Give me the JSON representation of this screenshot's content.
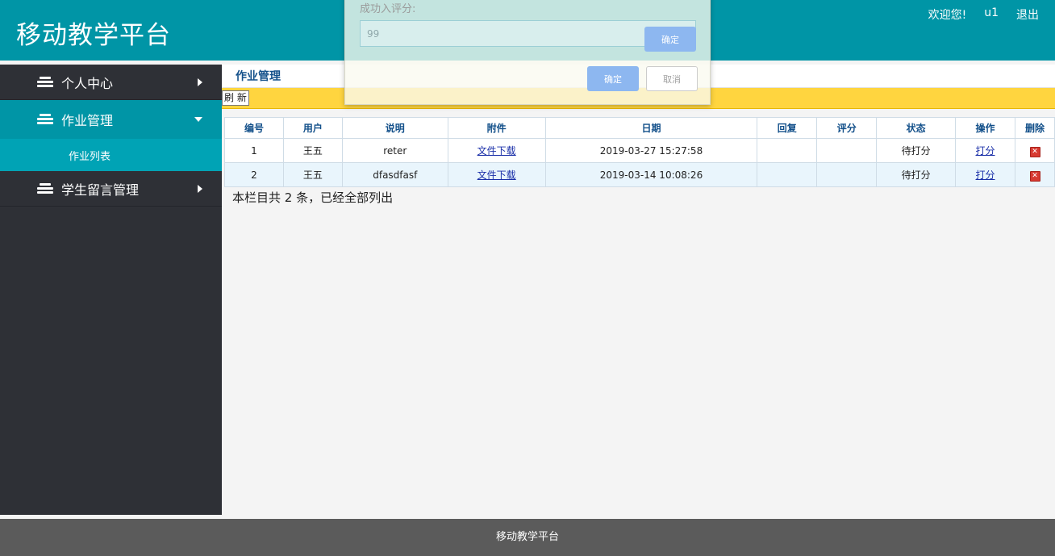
{
  "header": {
    "brand": "移动教学平台",
    "welcome": "欢迎您!",
    "username": "u1",
    "logout": "退出"
  },
  "sidebar": {
    "items": [
      {
        "label": "个人中心",
        "icon": "stack-icon"
      },
      {
        "label": "作业管理",
        "icon": "stack-icon",
        "subitems": [
          {
            "label": "作业列表"
          }
        ]
      },
      {
        "label": "学生留言管理",
        "icon": "stack-icon"
      }
    ]
  },
  "content": {
    "title": "作业管理",
    "refresh_label": "刷 新",
    "columns": [
      "编号",
      "用户",
      "说明",
      "附件",
      "日期",
      "回复",
      "评分",
      "状态",
      "操作",
      "删除"
    ],
    "rows": [
      {
        "id": "1",
        "user": "王五",
        "desc": "reter",
        "attachment": "文件下载",
        "date": "2019-03-27 15:27:58",
        "reply": "",
        "score": "",
        "status": "待打分",
        "action": "打分"
      },
      {
        "id": "2",
        "user": "王五",
        "desc": "dfasdfasf",
        "attachment": "文件下载",
        "date": "2019-03-14 10:08:26",
        "reply": "",
        "score": "",
        "status": "待打分",
        "action": "打分"
      }
    ],
    "count_text": "本栏目共 2 条，已经全部列出"
  },
  "modal": {
    "label": "成功入评分:",
    "input_value": "99",
    "inner_button": "确定",
    "ok_label": "确定",
    "cancel_label": "取消"
  },
  "footer": {
    "text": "移动教学平台"
  },
  "colors": {
    "header_bg": "#0095a6",
    "sidebar_bg": "#2e3036",
    "toolbar_bg": "#ffd53f",
    "footer_bg": "#5b5b5b"
  }
}
